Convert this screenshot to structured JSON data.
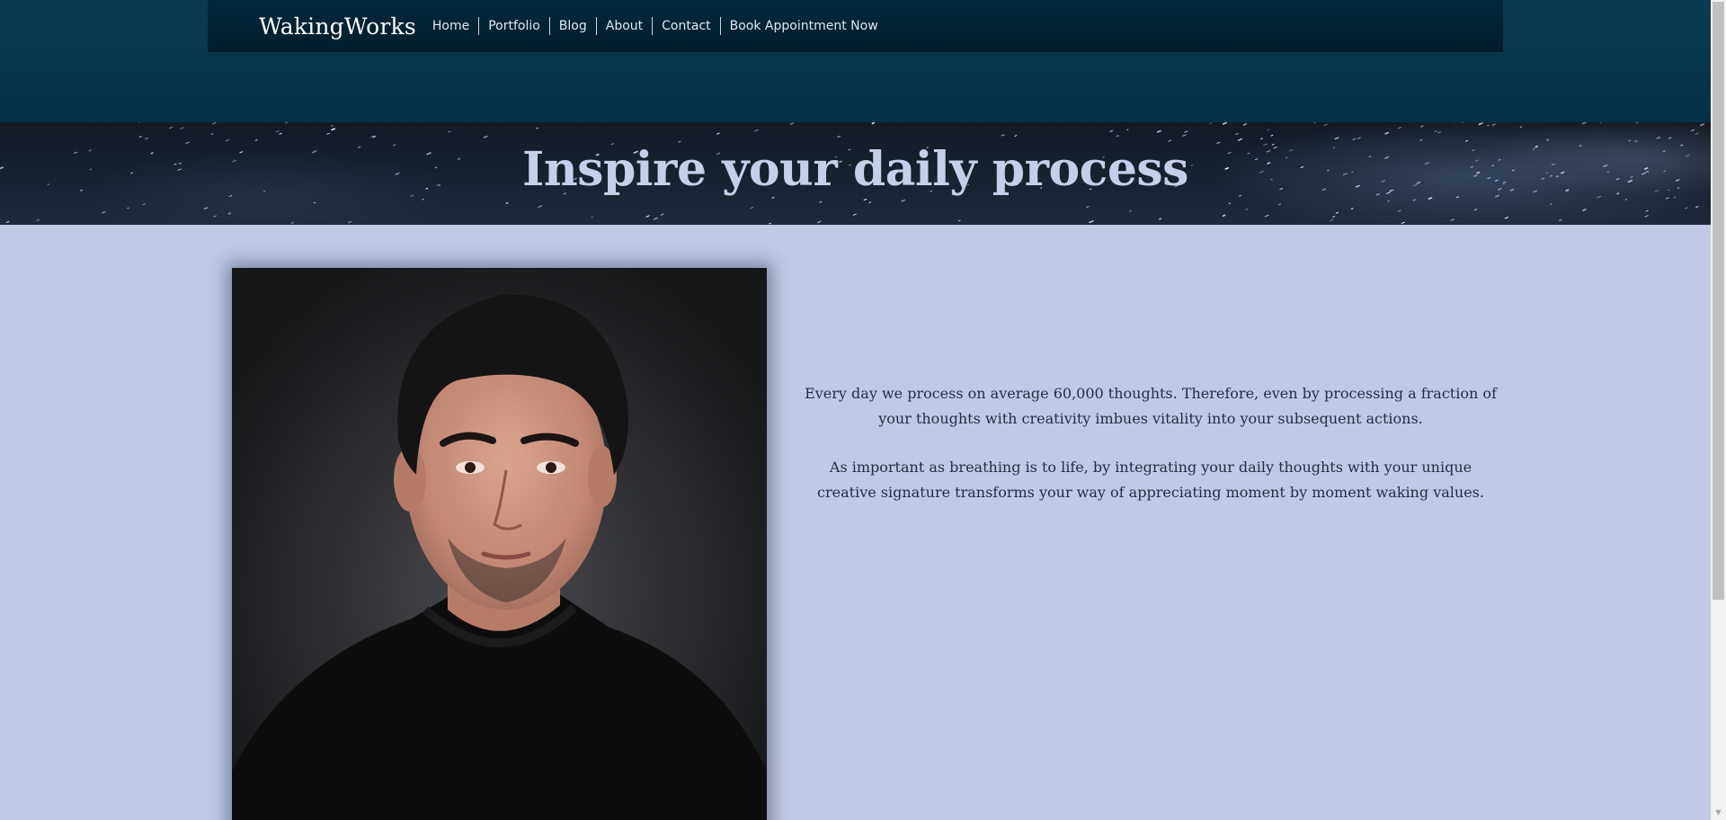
{
  "site": {
    "logo": "WakingWorks"
  },
  "nav": {
    "items": [
      {
        "label": "Home"
      },
      {
        "label": "Portfolio"
      },
      {
        "label": "Blog"
      },
      {
        "label": "About"
      },
      {
        "label": "Contact"
      },
      {
        "label": "Book Appointment Now"
      }
    ]
  },
  "hero": {
    "title": "Inspire your daily process"
  },
  "content": {
    "paragraph_1": "Every day we process on average 60,000 thoughts. Therefore, even by processing a fraction of your thoughts with creativity imbues vitality into your subsequent actions.",
    "paragraph_2": "As important as breathing is to life, by integrating your daily thoughts with your unique creative signature transforms your way of appreciating moment by moment waking values."
  },
  "colors": {
    "header_bg": "#053047",
    "navbar_bg": "#011c2c",
    "page_bg": "#bfcae6",
    "hero_title": "#c4cfea",
    "body_text": "#1f2e45"
  }
}
